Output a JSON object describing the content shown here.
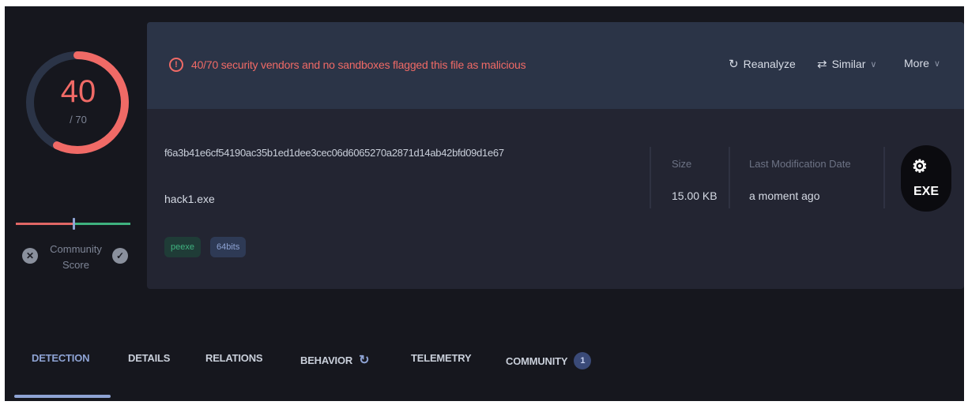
{
  "score": {
    "detections": "40",
    "total": "/ 70",
    "malicious_fraction": 0.571,
    "community_label": "Community Score",
    "community_position": 0.5
  },
  "alert": {
    "text": "40/70 security vendors and no sandboxes flagged this file as malicious"
  },
  "actions": {
    "reanalyze": "Reanalyze",
    "similar": "Similar",
    "more": "More"
  },
  "file": {
    "hash": "f6a3b41e6cf54190ac35b1ed1dee3cec06d6065270a2871d14ab42bfd09d1e67",
    "name": "hack1.exe",
    "tags": [
      "peexe",
      "64bits"
    ],
    "size_label": "Size",
    "size_value": "15.00 KB",
    "date_label": "Last Modification Date",
    "date_value": "a moment ago",
    "type_ext": "EXE"
  },
  "tabs": {
    "detection": "DETECTION",
    "details": "DETAILS",
    "relations": "RELATIONS",
    "behavior": "BEHAVIOR",
    "telemetry": "TELEMETRY",
    "community": "COMMUNITY",
    "community_count": "1"
  },
  "colors": {
    "malicious": "#f06a66",
    "accent": "#8ea3d4",
    "benign": "#3fb27f"
  }
}
